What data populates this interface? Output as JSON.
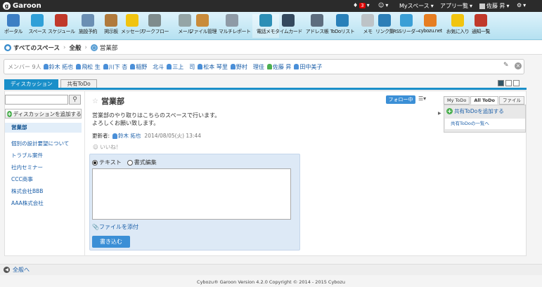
{
  "topbar": {
    "logo": "Garoon",
    "notification_count": "3",
    "myspace_label": "Myスペース",
    "apps_label": "アプリ一覧",
    "user_name": "佐藤 昇"
  },
  "apps": [
    {
      "label": "ポータル",
      "icon": "portal-icon",
      "color": "#3d7fc4"
    },
    {
      "label": "スペース",
      "icon": "space-icon",
      "color": "#2fa0d8"
    },
    {
      "label": "スケジュール",
      "icon": "calendar-icon",
      "color": "#c0392b"
    },
    {
      "label": "施設予約",
      "icon": "facility-icon",
      "color": "#6b8fb3"
    },
    {
      "label": "掲示板",
      "icon": "bulletin-icon",
      "color": "#b07a3c"
    },
    {
      "label": "メッセージ",
      "icon": "message-icon",
      "color": "#f1c40f"
    },
    {
      "label": "ワークフロー",
      "icon": "workflow-icon",
      "color": "#7f8c8d"
    },
    {
      "label": "メール",
      "icon": "mail-icon",
      "color": "#95a5a6"
    },
    {
      "label": "ファイル管理",
      "icon": "file-icon",
      "color": "#c98b3a"
    },
    {
      "label": "マルチレポート",
      "icon": "report-icon",
      "color": "#8e9aa6"
    },
    {
      "label": "電話メモ",
      "icon": "phone-icon",
      "color": "#2d8fb6"
    },
    {
      "label": "タイムカード",
      "icon": "timecard-icon",
      "color": "#34495e"
    },
    {
      "label": "アドレス帳",
      "icon": "address-icon",
      "color": "#5d6d7e"
    },
    {
      "label": "ToDoリスト",
      "icon": "todo-icon",
      "color": "#2980b9"
    },
    {
      "label": "メモ",
      "icon": "memo-icon",
      "color": "#bdc3c7"
    },
    {
      "label": "リンク集",
      "icon": "link-icon",
      "color": "#2c7fb8"
    },
    {
      "label": "RSSリーダー",
      "icon": "rss-icon",
      "color": "#3a9fd6"
    },
    {
      "label": "cybozu.net",
      "icon": "cybozu-icon",
      "color": "#e67e22"
    },
    {
      "label": "お気に入り",
      "icon": "favorite-icon",
      "color": "#f1c40f"
    },
    {
      "label": "通知一覧",
      "icon": "notice-icon",
      "color": "#c0392b"
    }
  ],
  "breadcrumb": {
    "root": "すべてのスペース",
    "category": "全般",
    "current": "営業部"
  },
  "members": {
    "label": "メンバー 9人",
    "list": [
      "鈴木 拓也",
      "飛松 生",
      "川下 杏",
      "稲野　北斗",
      "三上　司",
      "松本 琴里",
      "野村　理佳",
      "佐藤 昇",
      "田中美子"
    ]
  },
  "tabs": {
    "discussion": "ディスカッション",
    "shared_todo": "共有ToDo"
  },
  "sidebar": {
    "add_discussion": "ディスカッションを追加する",
    "current": "営業部",
    "items": [
      "個別の設計要望について",
      "トラブル案件",
      "社内セミナー",
      "CCC商事",
      "株式会社BBB",
      "AAA株式会社"
    ]
  },
  "main": {
    "title": "営業部",
    "follow_label": "フォロー中",
    "desc_line1": "営業部のやり取りはこちらのスペースで行います。",
    "desc_line2": "よろしくお願い致します。",
    "updater_label": "更新者:",
    "updater_name": "鈴木 拓也",
    "updated_at": "2014/08/05(火) 13:44",
    "like_label": "いいね！"
  },
  "editor": {
    "radio_text": "テキスト",
    "radio_rich": "書式編集",
    "attach_label": "ファイルを添付",
    "submit_label": "書き込む"
  },
  "right_panel": {
    "tab_my": "My ToDo",
    "tab_all": "All ToDo",
    "tab_file": "ファイル",
    "add_label": "共有ToDoを追加する",
    "list_label": "共有ToDoの一覧へ"
  },
  "footer": {
    "back_label": "全般へ",
    "copyright": "Cybozu® Garoon Version 4.2.0   Copyright © 2014 - 2015 Cybozu"
  }
}
